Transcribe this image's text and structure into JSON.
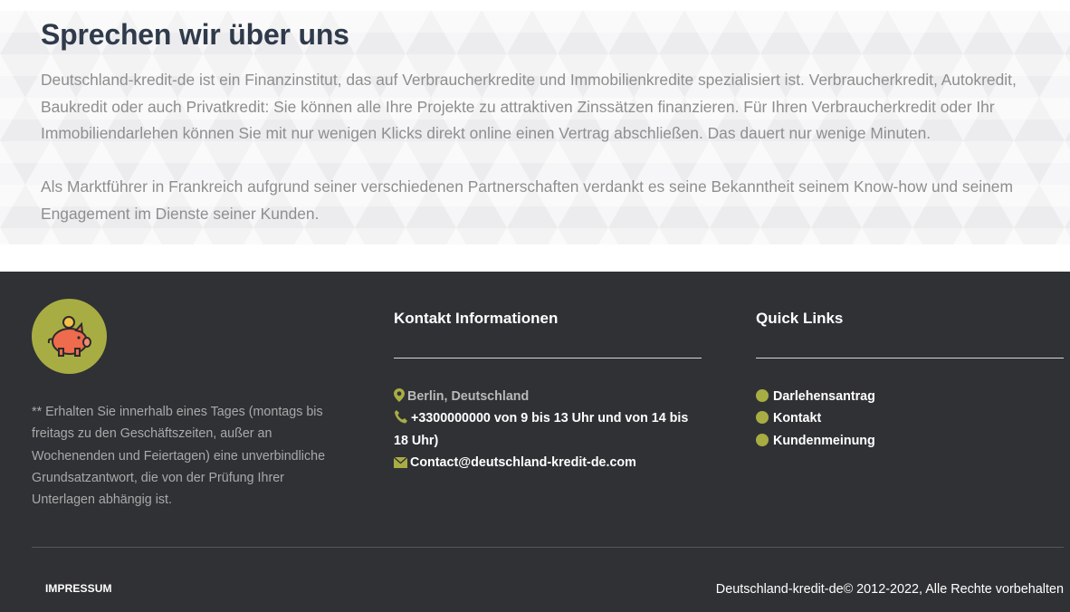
{
  "about": {
    "title": "Sprechen wir über uns",
    "paragraph1": "Deutschland-kredit-de ist ein Finanzinstitut, das auf Verbraucherkredite und Immobilienkredite spezialisiert ist. Verbraucherkredit, Autokredit, Baukredit oder auch Privatkredit: Sie können alle Ihre Projekte zu attraktiven Zinssätzen finanzieren. Für Ihren Verbraucherkredit oder Ihr Immobiliendarlehen können Sie mit nur wenigen Klicks direkt online einen Vertrag abschließen. Das dauert nur wenige Minuten.",
    "paragraph2": "Als Marktführer in Frankreich aufgrund seiner verschiedenen Partnerschaften verdankt es seine Bekanntheit seinem Know-how und seinem Engagement im Dienste seiner Kunden."
  },
  "footer": {
    "logo_icon": "piggy-bank-icon",
    "disclaimer": "** Erhalten Sie innerhalb eines Tages (montags bis freitags zu den Geschäftszeiten, außer an Wochenenden und Feiertagen) eine unverbindliche Grundsatzantwort, die von der Prüfung Ihrer Unterlagen abhängig ist.",
    "contact": {
      "title": "Kontakt Informationen",
      "location": "Berlin, Deutschland",
      "phone": "+3300000000 von 9 bis 13 Uhr und von 14 bis 18 Uhr)",
      "email": "Contact@deutschland-kredit-de.com"
    },
    "quick_links": {
      "title": "Quick Links",
      "items": [
        "Darlehensantrag",
        "Kontakt",
        "Kundenmeinung"
      ]
    },
    "impressum": "IMPRESSUM",
    "copyright": "Deutschland-kredit-de© 2012-2022, Alle Rechte vorbehalten"
  },
  "colors": {
    "accent": "#a8ad43",
    "footer_bg": "#303135",
    "title": "#2f3a4a",
    "body_text": "#8e8e8e"
  }
}
